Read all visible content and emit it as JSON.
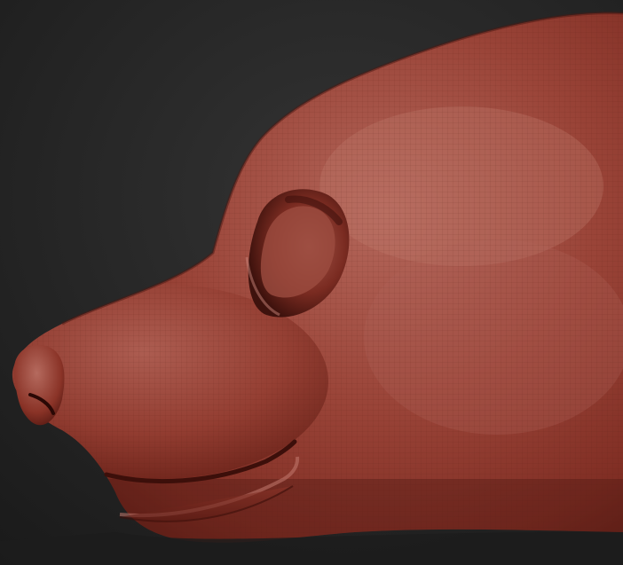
{
  "scene": {
    "subject": "sculpted-animal-head",
    "view": "side-profile-facing-left"
  },
  "colors": {
    "background_top": "#2f2f2f",
    "background_bottom": "#1c1c1c",
    "clay_base": "#8a3328",
    "clay_highlight": "#b8685c",
    "clay_shadow": "#4a1712",
    "wire": "#5c1f18"
  },
  "icons": {}
}
